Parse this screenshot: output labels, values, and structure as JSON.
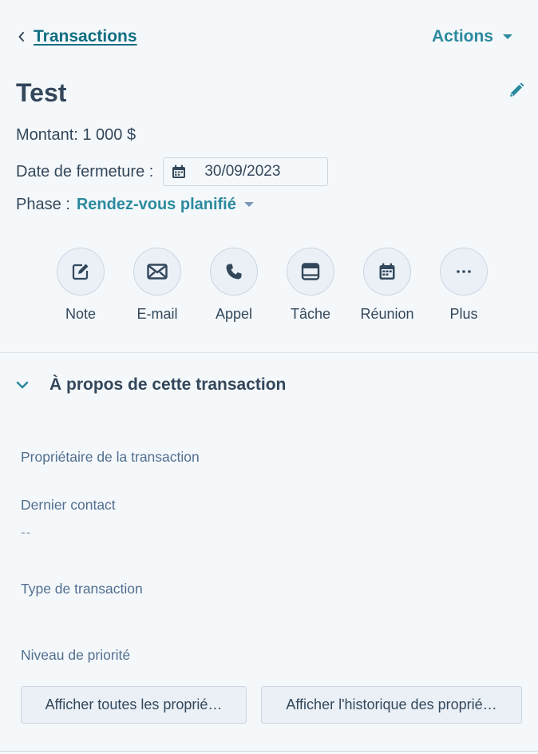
{
  "header": {
    "back_label": "Transactions",
    "actions_label": "Actions"
  },
  "record": {
    "title": "Test",
    "amount_text": "Montant: 1 000 $",
    "close_date_label": "Date de fermeture :",
    "close_date_value": "30/09/2023",
    "phase_label": "Phase :",
    "phase_value": "Rendez-vous planifié"
  },
  "quick_actions": [
    {
      "label": "Note",
      "icon": "note-edit-icon"
    },
    {
      "label": "E-mail",
      "icon": "envelope-icon"
    },
    {
      "label": "Appel",
      "icon": "phone-icon"
    },
    {
      "label": "Tâche",
      "icon": "task-icon"
    },
    {
      "label": "Réunion",
      "icon": "calendar-meeting-icon"
    },
    {
      "label": "Plus",
      "icon": "more-dots-icon"
    }
  ],
  "about_section": {
    "title": "À propos de cette transaction",
    "properties": [
      {
        "label": "Propriétaire de la transaction",
        "value": ""
      },
      {
        "label": "Dernier contact",
        "value": "--"
      },
      {
        "label": "Type de transaction",
        "value": ""
      },
      {
        "label": "Niveau de priorité",
        "value": ""
      }
    ],
    "buttons": {
      "all_properties": "Afficher toutes les proprié…",
      "property_history": "Afficher l'historique des proprié…"
    }
  },
  "colors": {
    "accent": "#2b8a9e",
    "link": "#0f6e82",
    "text": "#33475b",
    "muted": "#516f90",
    "background": "#f5f8fa",
    "button_bg": "#eaf0f6",
    "border": "#cbd6e2"
  }
}
